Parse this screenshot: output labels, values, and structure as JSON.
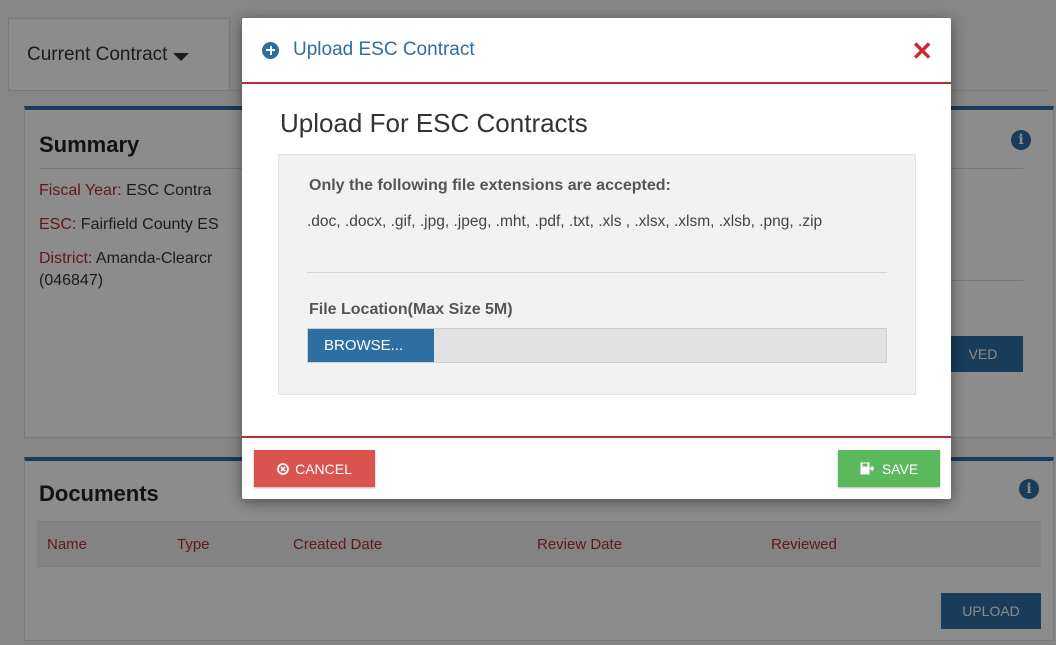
{
  "background": {
    "tab_label": "Current Contract",
    "summary": {
      "title": "Summary",
      "fiscal_year_label": "Fiscal Year:",
      "fiscal_year_value": "ESC Contra",
      "esc_label": "ESC:",
      "esc_value": "Fairfield County ES",
      "district_label": "District:",
      "district_value": "Amanda-Clearcr",
      "district_code": "(046847)",
      "button_fragment": "VED"
    },
    "documents": {
      "title": "Documents",
      "columns": [
        "Name",
        "Type",
        "Created Date",
        "Review Date",
        "Reviewed"
      ],
      "upload_label": "UPLOAD"
    }
  },
  "modal": {
    "title": "Upload ESC Contract",
    "close_symbol": "✕",
    "heading": "Upload For ESC Contracts",
    "extensions_title": "Only the following file extensions are accepted:",
    "extensions_list": ".doc, .docx, .gif, .jpg, .jpeg, .mht, .pdf, .txt, .xls , .xlsx, .xlsm, .xlsb, .png, .zip",
    "file_location_label": "File Location(Max Size 5M)",
    "browse_label": "BROWSE...",
    "cancel_label": "CANCEL",
    "save_label": "SAVE"
  },
  "colors": {
    "primary": "#2d6ea3",
    "danger": "#d9534f",
    "success": "#5cb85c",
    "label_red": "#b12f36"
  }
}
